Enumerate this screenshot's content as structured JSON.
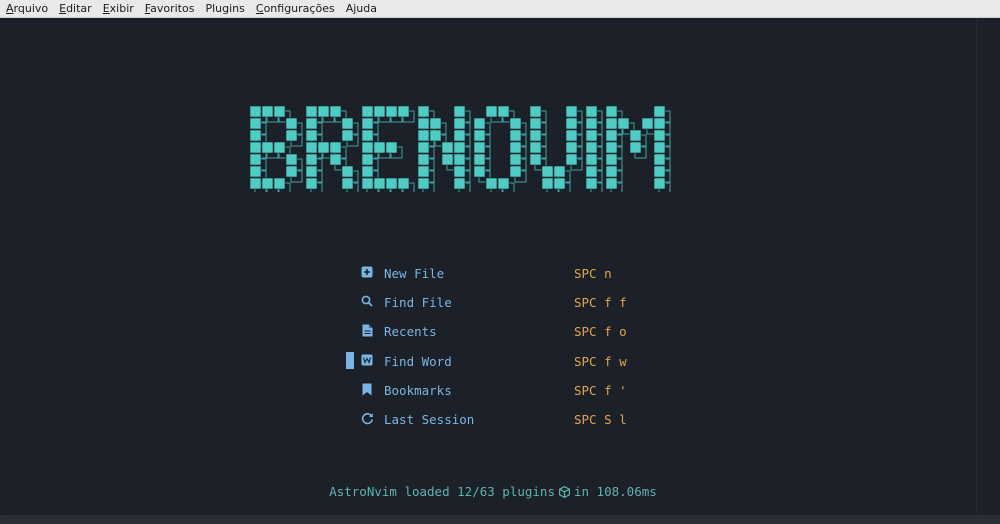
{
  "menubar": {
    "items": [
      {
        "mnemonic": "A",
        "rest": "rquivo"
      },
      {
        "mnemonic": "E",
        "rest": "ditar"
      },
      {
        "mnemonic": "E",
        "rest": "xibir",
        "pre": ""
      },
      {
        "mnemonic": "F",
        "rest": "avoritos"
      },
      {
        "mnemonic": "",
        "rest": "Plugins"
      },
      {
        "mnemonic": "C",
        "rest": "onfigurações"
      },
      {
        "pre": "A",
        "mnemonic": "j",
        "rest": "uda"
      }
    ]
  },
  "logo": {
    "text": "BRENOVIM",
    "color": "#4ecdc4"
  },
  "dashboard": {
    "entries": [
      {
        "icon": "new-file-icon",
        "label": "New File",
        "key": "SPC n"
      },
      {
        "icon": "search-icon",
        "label": "Find File",
        "key": "SPC f f"
      },
      {
        "icon": "document-icon",
        "label": "Recents",
        "key": "SPC f o"
      },
      {
        "icon": "word-icon",
        "label": "Find Word",
        "key": "SPC f w"
      },
      {
        "icon": "bookmark-icon",
        "label": "Bookmarks",
        "key": "SPC f '"
      },
      {
        "icon": "restore-session-icon",
        "label": "Last Session",
        "key": "SPC S l"
      }
    ],
    "selected_index": 3
  },
  "footer": {
    "prefix": "AstroNvim loaded 12/63 plugins",
    "suffix": "in 108.06ms"
  },
  "colors": {
    "background": "#1b2029",
    "label": "#7ab6e3",
    "key": "#e3a54a",
    "footer": "#59b7b0"
  }
}
